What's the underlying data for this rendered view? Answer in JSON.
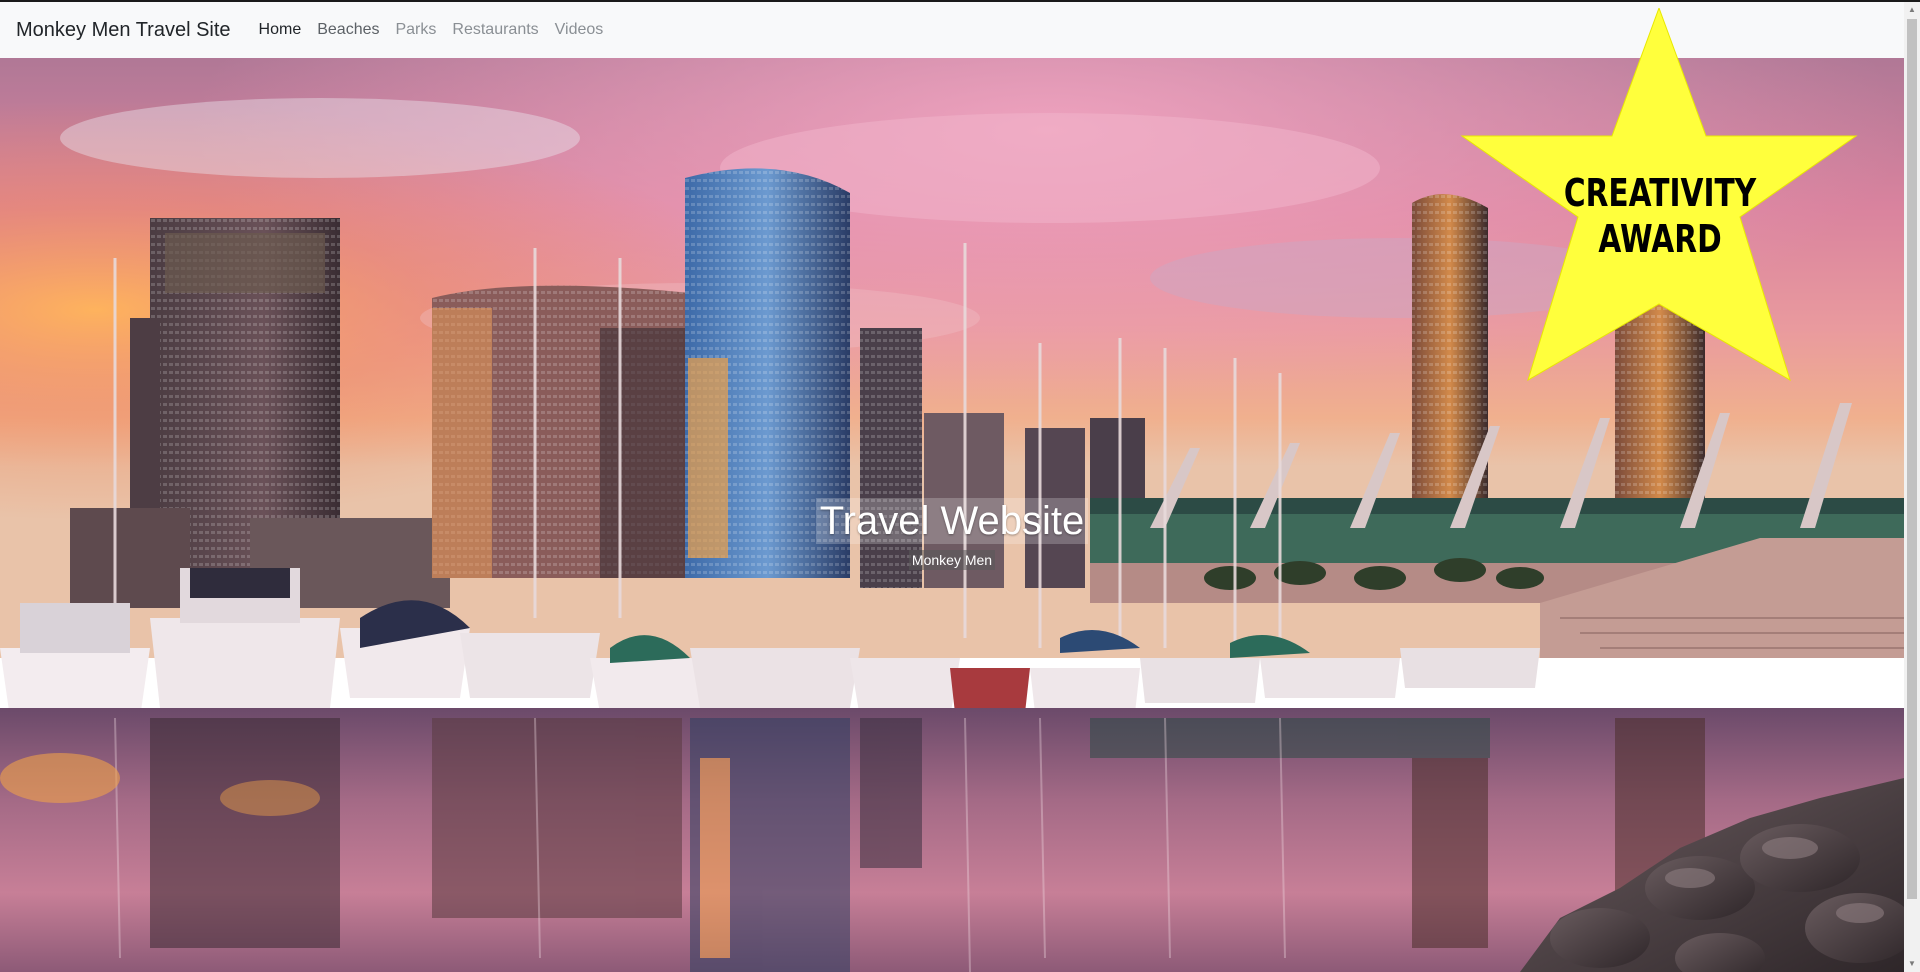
{
  "navbar": {
    "brand": "Monkey Men Travel Site",
    "links": [
      {
        "label": "Home",
        "state": "active"
      },
      {
        "label": "Beaches",
        "state": "default"
      },
      {
        "label": "Parks",
        "state": "muted"
      },
      {
        "label": "Restaurants",
        "state": "muted"
      },
      {
        "label": "Videos",
        "state": "muted"
      }
    ]
  },
  "hero": {
    "title": "Travel Website",
    "subtitle": "Monkey Men",
    "image_subject": "city marina skyline at sunset with reflections"
  },
  "award": {
    "line1": "CREATIVITY",
    "line2": "AWARD",
    "star_color": "#ffff3c"
  },
  "colors": {
    "navbar_bg": "#f8f9fa",
    "nav_active": "#212529",
    "nav_muted": "#8a8f94"
  }
}
